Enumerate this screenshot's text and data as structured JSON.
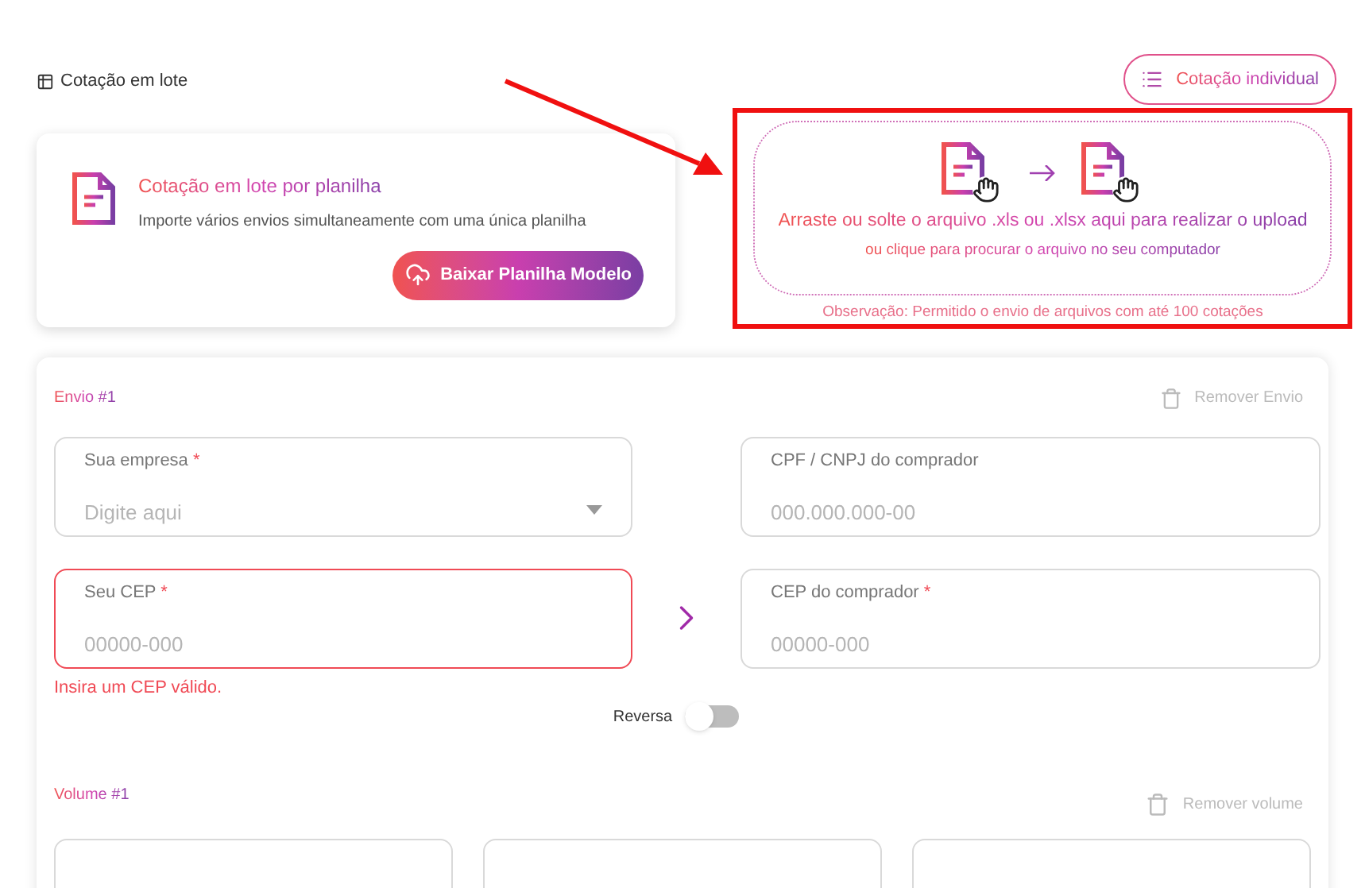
{
  "header": {
    "title": "Cotação em lote",
    "individual_button": "Cotação individual"
  },
  "spreadsheet_card": {
    "title": "Cotação em lote por planilha",
    "description": "Importe vários envios simultaneamente com uma única planilha",
    "download_button": "Baixar Planilha Modelo"
  },
  "upload": {
    "instruction": "Arraste ou solte o arquivo .xls ou .xlsx aqui para realizar o upload",
    "hint": "ou clique para procurar o arquivo no seu computador",
    "note": "Observação: Permitido o envio de arquivos com até 100 cotações"
  },
  "shipment": {
    "title": "Envio #1",
    "remove": "Remover Envio",
    "fields": [
      {
        "kind": "select",
        "label": "Sua empresa",
        "required_mark": "*",
        "placeholder": "Digite aqui"
      },
      {
        "kind": "text",
        "label": "CPF / CNPJ do comprador",
        "placeholder": "000.000.000-00"
      },
      {
        "kind": "text",
        "label": "Seu CEP",
        "required_mark": "*",
        "placeholder": "00000-000",
        "error": "Insira um CEP válido."
      },
      {
        "kind": "text",
        "label": "CEP do comprador",
        "required_mark": "*",
        "placeholder": "00000-000"
      }
    ],
    "toggle": {
      "label": "Reversa",
      "on": false
    }
  },
  "volume": {
    "title": "Volume #1",
    "remove": "Remover volume",
    "fields": [
      {
        "kind": "cut"
      },
      {
        "kind": "cut"
      },
      {
        "kind": "cut"
      }
    ]
  }
}
